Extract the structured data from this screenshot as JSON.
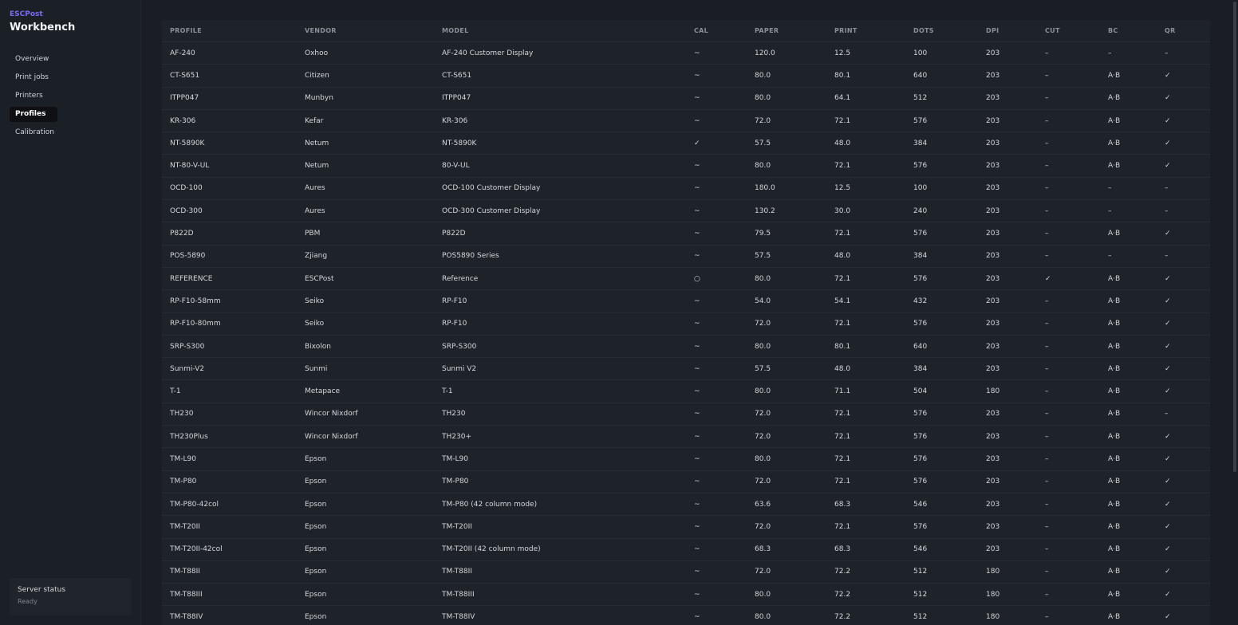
{
  "brand": {
    "small": "ESCPost",
    "title": "Workbench"
  },
  "nav": [
    {
      "label": "Overview",
      "active": false
    },
    {
      "label": "Print jobs",
      "active": false
    },
    {
      "label": "Printers",
      "active": false
    },
    {
      "label": "Profiles",
      "active": true
    },
    {
      "label": "Calibration",
      "active": false
    }
  ],
  "status": {
    "title": "Server status",
    "value": "Ready"
  },
  "table": {
    "headers": [
      "PROFILE",
      "VENDOR",
      "MODEL",
      "CAL",
      "PAPER",
      "PRINT",
      "DOTS",
      "DPI",
      "CUT",
      "BC",
      "QR"
    ],
    "rows": [
      [
        "AF-240",
        "Oxhoo",
        "AF-240 Customer Display",
        "~",
        "120.0",
        "12.5",
        "100",
        "203",
        "–",
        "–",
        "–"
      ],
      [
        "CT-S651",
        "Citizen",
        "CT-S651",
        "~",
        "80.0",
        "80.1",
        "640",
        "203",
        "–",
        "A·B",
        "✓"
      ],
      [
        "ITPP047",
        "Munbyn",
        "ITPP047",
        "~",
        "80.0",
        "64.1",
        "512",
        "203",
        "–",
        "A·B",
        "✓"
      ],
      [
        "KR-306",
        "Kefar",
        "KR-306",
        "~",
        "72.0",
        "72.1",
        "576",
        "203",
        "–",
        "A·B",
        "✓"
      ],
      [
        "NT-5890K",
        "Netum",
        "NT-5890K",
        "✓",
        "57.5",
        "48.0",
        "384",
        "203",
        "–",
        "A·B",
        "✓"
      ],
      [
        "NT-80-V-UL",
        "Netum",
        "80-V-UL",
        "~",
        "80.0",
        "72.1",
        "576",
        "203",
        "–",
        "A·B",
        "✓"
      ],
      [
        "OCD-100",
        "Aures",
        "OCD-100 Customer Display",
        "~",
        "180.0",
        "12.5",
        "100",
        "203",
        "–",
        "–",
        "–"
      ],
      [
        "OCD-300",
        "Aures",
        "OCD-300 Customer Display",
        "~",
        "130.2",
        "30.0",
        "240",
        "203",
        "–",
        "–",
        "–"
      ],
      [
        "P822D",
        "PBM",
        "P822D",
        "~",
        "79.5",
        "72.1",
        "576",
        "203",
        "–",
        "A·B",
        "✓"
      ],
      [
        "POS-5890",
        "Zjiang",
        "POS5890 Series",
        "~",
        "57.5",
        "48.0",
        "384",
        "203",
        "–",
        "–",
        "–"
      ],
      [
        "REFERENCE",
        "ESCPost",
        "Reference",
        "○",
        "80.0",
        "72.1",
        "576",
        "203",
        "✓",
        "A·B",
        "✓"
      ],
      [
        "RP-F10-58mm",
        "Seiko",
        "RP-F10",
        "~",
        "54.0",
        "54.1",
        "432",
        "203",
        "–",
        "A·B",
        "✓"
      ],
      [
        "RP-F10-80mm",
        "Seiko",
        "RP-F10",
        "~",
        "72.0",
        "72.1",
        "576",
        "203",
        "–",
        "A·B",
        "✓"
      ],
      [
        "SRP-S300",
        "Bixolon",
        "SRP-S300",
        "~",
        "80.0",
        "80.1",
        "640",
        "203",
        "–",
        "A·B",
        "✓"
      ],
      [
        "Sunmi-V2",
        "Sunmi",
        "Sunmi V2",
        "~",
        "57.5",
        "48.0",
        "384",
        "203",
        "–",
        "A·B",
        "✓"
      ],
      [
        "T-1",
        "Metapace",
        "T-1",
        "~",
        "80.0",
        "71.1",
        "504",
        "180",
        "–",
        "A·B",
        "✓"
      ],
      [
        "TH230",
        "Wincor Nixdorf",
        "TH230",
        "~",
        "72.0",
        "72.1",
        "576",
        "203",
        "–",
        "A·B",
        "–"
      ],
      [
        "TH230Plus",
        "Wincor Nixdorf",
        "TH230+",
        "~",
        "72.0",
        "72.1",
        "576",
        "203",
        "–",
        "A·B",
        "✓"
      ],
      [
        "TM-L90",
        "Epson",
        "TM-L90",
        "~",
        "80.0",
        "72.1",
        "576",
        "203",
        "–",
        "A·B",
        "✓"
      ],
      [
        "TM-P80",
        "Epson",
        "TM-P80",
        "~",
        "72.0",
        "72.1",
        "576",
        "203",
        "–",
        "A·B",
        "✓"
      ],
      [
        "TM-P80-42col",
        "Epson",
        "TM-P80 (42 column mode)",
        "~",
        "63.6",
        "68.3",
        "546",
        "203",
        "–",
        "A·B",
        "✓"
      ],
      [
        "TM-T20II",
        "Epson",
        "TM-T20II",
        "~",
        "72.0",
        "72.1",
        "576",
        "203",
        "–",
        "A·B",
        "✓"
      ],
      [
        "TM-T20II-42col",
        "Epson",
        "TM-T20II (42 column mode)",
        "~",
        "68.3",
        "68.3",
        "546",
        "203",
        "–",
        "A·B",
        "✓"
      ],
      [
        "TM-T88II",
        "Epson",
        "TM-T88II",
        "~",
        "72.0",
        "72.2",
        "512",
        "180",
        "–",
        "A·B",
        "✓"
      ],
      [
        "TM-T88III",
        "Epson",
        "TM-T88III",
        "~",
        "80.0",
        "72.2",
        "512",
        "180",
        "–",
        "A·B",
        "✓"
      ],
      [
        "TM-T88IV",
        "Epson",
        "TM-T88IV",
        "~",
        "80.0",
        "72.2",
        "512",
        "180",
        "–",
        "A·B",
        "✓"
      ]
    ]
  }
}
